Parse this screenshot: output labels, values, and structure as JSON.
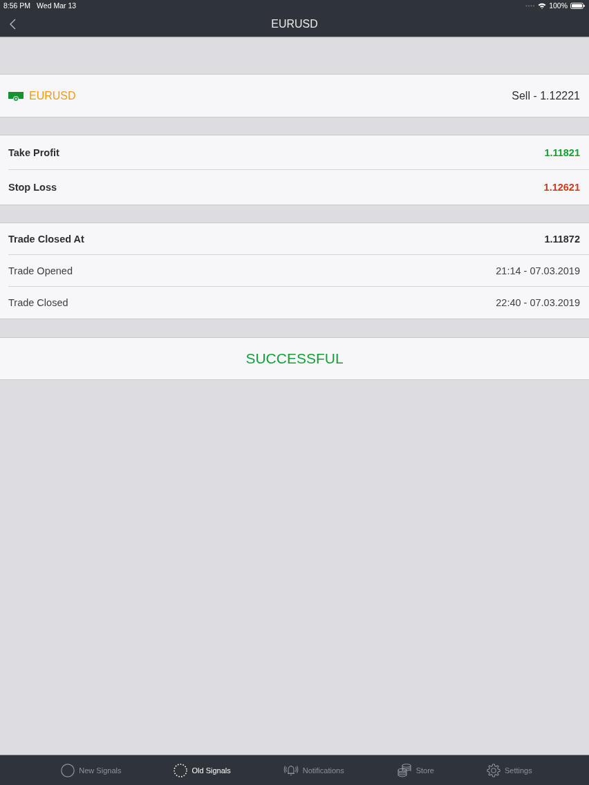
{
  "status_bar": {
    "time": "8:56 PM",
    "date": "Wed Mar 13",
    "battery": "100%"
  },
  "nav_bar": {
    "title": "EURUSD"
  },
  "signal": {
    "pair": "EURUSD",
    "direction": "Sell - 1.12221"
  },
  "targets": [
    {
      "label": "Take Profit",
      "value": "1.11821",
      "color": "#1a9e35"
    },
    {
      "label": "Stop Loss",
      "value": "1.12621",
      "color": "#cc3a1f"
    }
  ],
  "details": [
    {
      "label": "Trade Closed At",
      "value": "1.11872",
      "emphasized": true
    },
    {
      "label": "Trade Opened",
      "value": "21:14 - 07.03.2019",
      "emphasized": false
    },
    {
      "label": "Trade Closed",
      "value": "22:40 - 07.03.2019",
      "emphasized": false
    }
  ],
  "result": {
    "text": "SUCCESSFUL",
    "kind": "success"
  },
  "tab_bar": [
    {
      "label": "New Signals",
      "selected": false
    },
    {
      "label": "Old Signals",
      "selected": true
    },
    {
      "label": "Notifications",
      "selected": false
    },
    {
      "label": "Store",
      "selected": false
    },
    {
      "label": "Settings",
      "selected": false
    }
  ]
}
